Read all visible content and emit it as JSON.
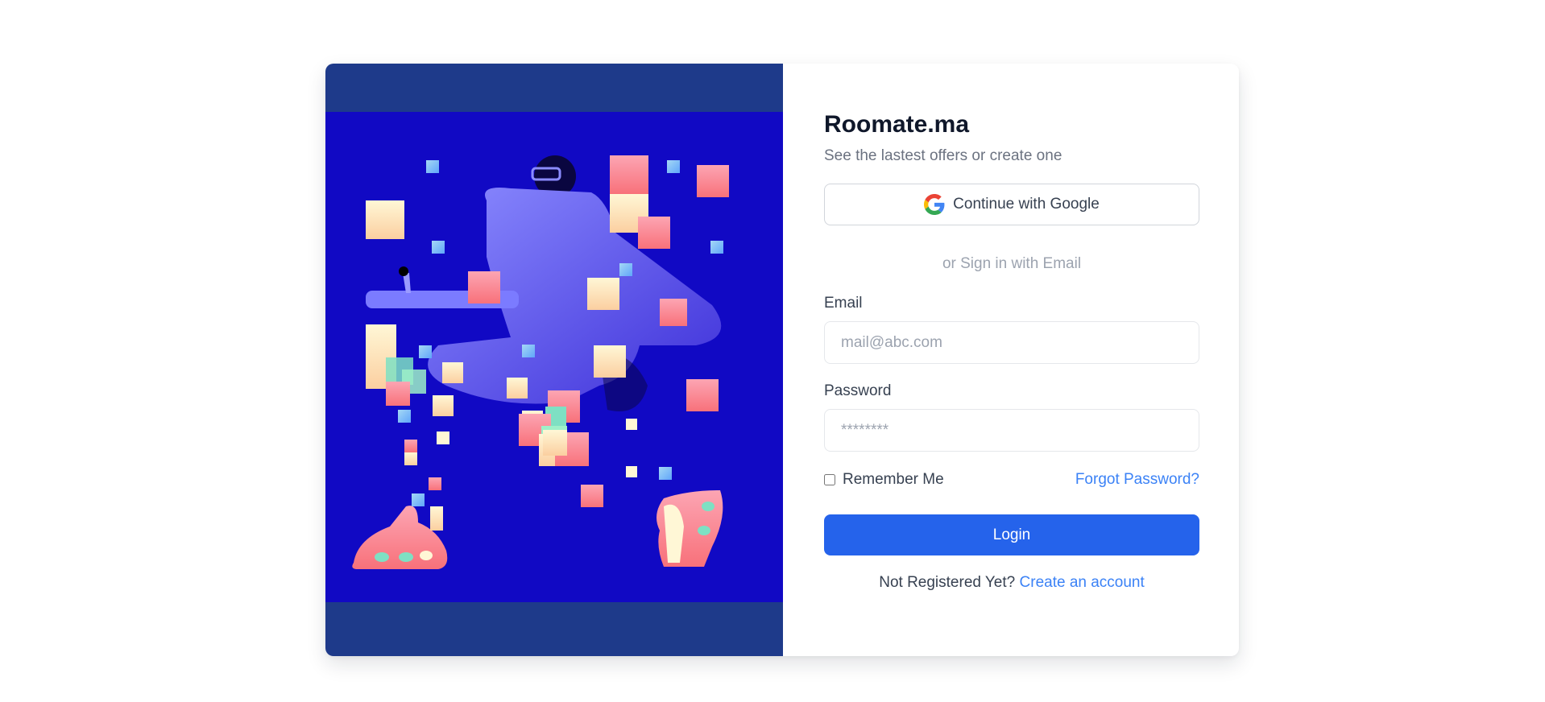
{
  "brand": {
    "title": "Roomate.ma",
    "subtitle": "See the lastest offers or create one"
  },
  "google": {
    "label": "Continue with Google",
    "icon": "google-g-icon"
  },
  "divider": {
    "text": "or Sign in with Email"
  },
  "email": {
    "label": "Email",
    "placeholder": "mail@abc.com",
    "value": ""
  },
  "password": {
    "label": "Password",
    "placeholder": "********",
    "value": ""
  },
  "remember": {
    "label": "Remember Me",
    "checked": false
  },
  "forgot": {
    "label": "Forgot Password?"
  },
  "login": {
    "label": "Login"
  },
  "register": {
    "prompt": "Not Registered Yet?",
    "link": "Create an account"
  },
  "colors": {
    "primary": "#2563eb",
    "link": "#3b82f6",
    "left_pane": "#1e3a8a",
    "illustration_bg": "#1109c4"
  }
}
